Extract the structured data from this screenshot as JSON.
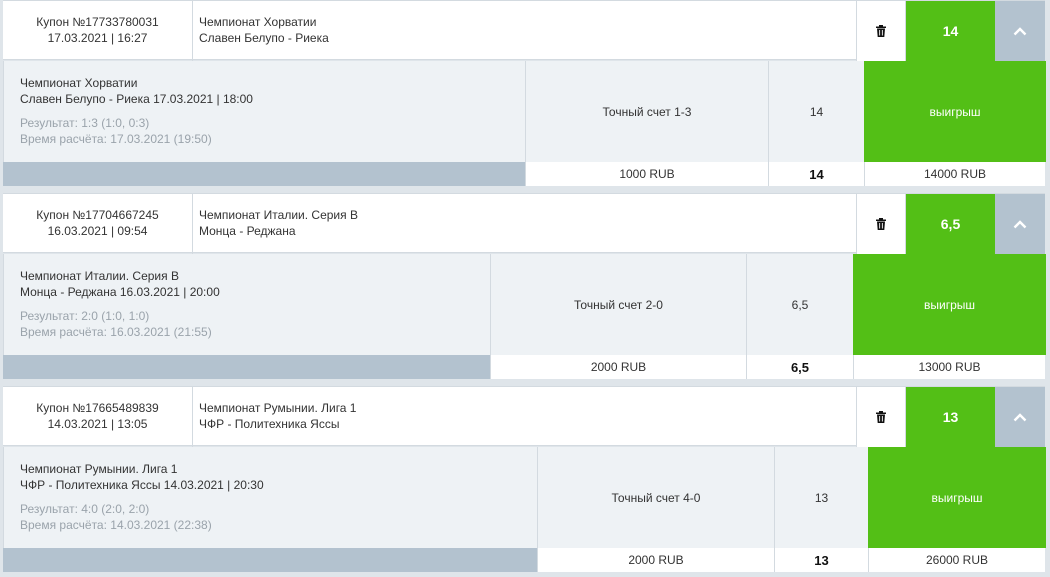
{
  "coupons": [
    {
      "coupon_id": "Купон №17733780031",
      "datetime": "17.03.2021 | 16:27",
      "league": "Чемпионат Хорватии",
      "match": "Славен Белупо - Риека",
      "odds": "14",
      "detail": {
        "league": "Чемпионат Хорватии",
        "match_line": "Славен Белупо - Риека 17.03.2021 | 18:00",
        "result": "Результат: 1:3 (1:0, 0:3)",
        "calc_time": "Время расчёта: 17.03.2021 (19:50)",
        "bet": "Точный счет 1-3",
        "odds": "14",
        "status": "выигрыш"
      },
      "footer": {
        "stake": "1000 RUB",
        "odds": "14",
        "payout": "14000 RUB"
      }
    },
    {
      "coupon_id": "Купон №17704667245",
      "datetime": "16.03.2021 | 09:54",
      "league": "Чемпионат Италии. Серия B",
      "match": "Монца - Реджана",
      "odds": "6,5",
      "detail": {
        "league": "Чемпионат Италии. Серия B",
        "match_line": "Монца - Реджана 16.03.2021 | 20:00",
        "result": "Результат: 2:0 (1:0, 1:0)",
        "calc_time": "Время расчёта: 16.03.2021 (21:55)",
        "bet": "Точный счет 2-0",
        "odds": "6,5",
        "status": "выигрыш"
      },
      "footer": {
        "stake": "2000 RUB",
        "odds": "6,5",
        "payout": "13000 RUB"
      }
    },
    {
      "coupon_id": "Купон №17665489839",
      "datetime": "14.03.2021 | 13:05",
      "league": "Чемпионат Румынии. Лига 1",
      "match": "ЧФР - Политехника Яссы",
      "odds": "13",
      "detail": {
        "league": "Чемпионат Румынии. Лига 1",
        "match_line": "ЧФР - Политехника Яссы 14.03.2021 | 20:30",
        "result": "Результат: 4:0 (2:0, 2:0)",
        "calc_time": "Время расчёта: 14.03.2021 (22:38)",
        "bet": "Точный счет 4-0",
        "odds": "13",
        "status": "выигрыш"
      },
      "footer": {
        "stake": "2000 RUB",
        "odds": "13",
        "payout": "26000 RUB"
      }
    }
  ],
  "icons": {
    "delete": "trash-icon",
    "collapse": "chevron-up-icon"
  },
  "colors": {
    "win": "#53bf16",
    "footer_bar": "#b3c2cf",
    "detail_bg": "#eef2f5",
    "muted_text": "#9aa3ab"
  }
}
